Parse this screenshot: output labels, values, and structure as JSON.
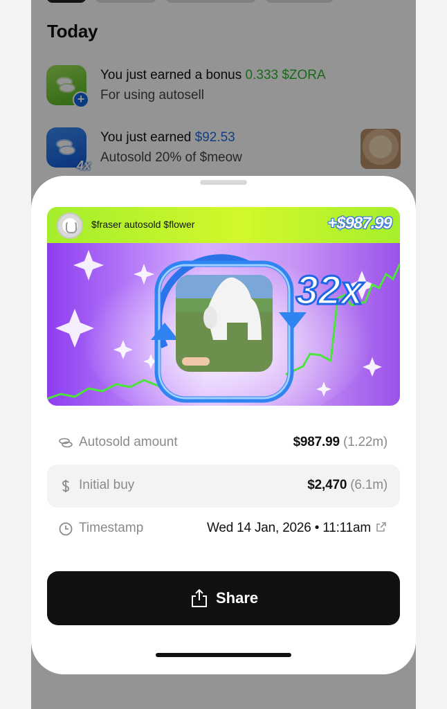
{
  "feed": {
    "section_title": "Today",
    "items": [
      {
        "prefix": "You just earned a bonus",
        "amount": "0.333 $ZORA",
        "subtitle": "For using autosell"
      },
      {
        "prefix": "You just earned",
        "amount": "$92.53",
        "subtitle": "Autosold 20% of $meow"
      }
    ]
  },
  "card": {
    "title": "$fraser autosold $flower",
    "amount": "+$987.99",
    "multiplier": "32x"
  },
  "stats": [
    {
      "label": "Autosold amount",
      "value": "$987.99",
      "sub": "(1.22m)"
    },
    {
      "label": "Initial buy",
      "value": "$2,470",
      "sub": "(6.1m)"
    },
    {
      "label": "Timestamp",
      "value": "Wed 14 Jan, 2026 • 11:11am",
      "sub": ""
    }
  ],
  "share_label": "Share",
  "icons": {
    "coins": "coins-icon",
    "dollar": "dollar-icon",
    "clock": "clock-icon",
    "external": "external-link-icon",
    "share": "share-icon"
  },
  "colors": {
    "accent_green": "#2cb52f",
    "accent_blue": "#1f6de0",
    "button": "#111111",
    "card_header": "#c6f52b"
  }
}
